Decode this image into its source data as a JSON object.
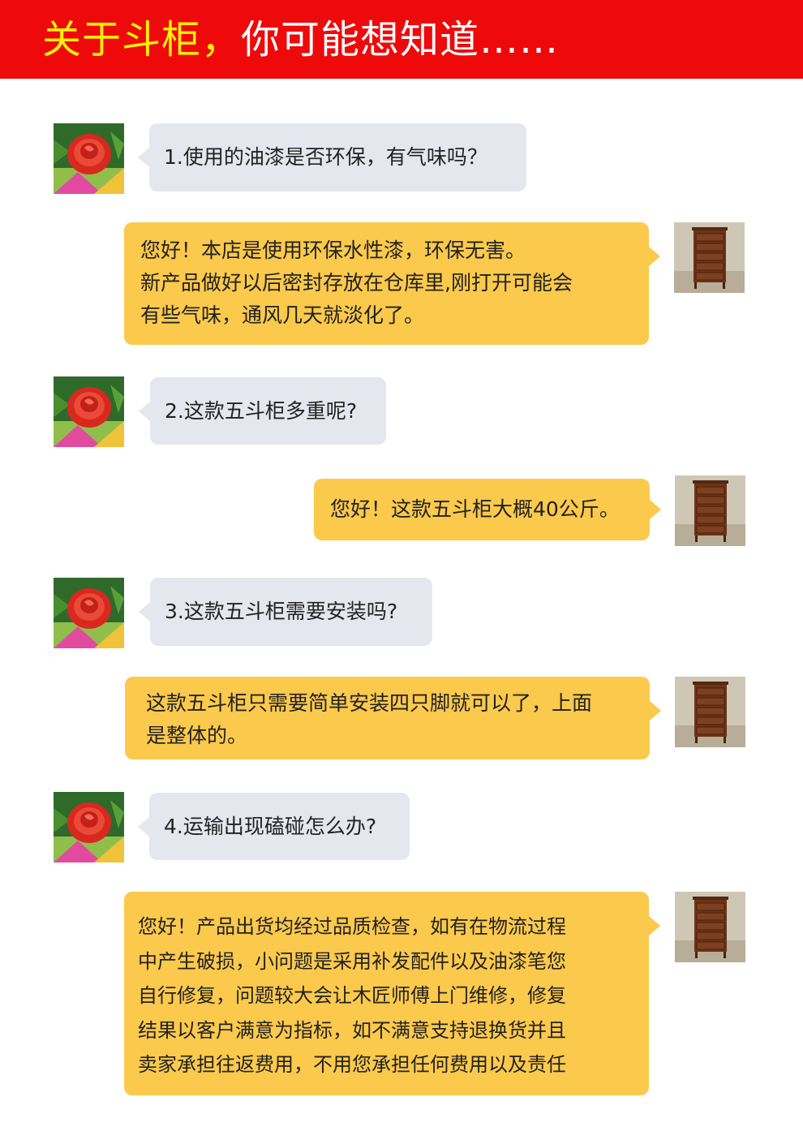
{
  "header": {
    "title_highlight": "关于斗柜，",
    "title_rest": "你可能想知道……"
  },
  "colors": {
    "header_bg": "#ee0a0b",
    "highlight_text": "#fff200",
    "question_bubble": "#e4e7ee",
    "answer_bubble": "#fbc94c"
  },
  "avatars": {
    "customer": "rose-photo-avatar",
    "seller": "dresser-photo-avatar"
  },
  "faq": [
    {
      "question": "1.使用的油漆是否环保，有气味吗？",
      "answer": [
        "您好！本店是使用环保水性漆，环保无害。",
        "新产品做好以后密封存放在仓库里,刚打开可能会",
        "有些气味，通风几天就淡化了。"
      ]
    },
    {
      "question": "2.这款五斗柜多重呢?",
      "answer": [
        "您好！这款五斗柜大概40公斤。"
      ]
    },
    {
      "question": "3.这款五斗柜需要安装吗?",
      "answer": [
        "这款五斗柜只需要简单安装四只脚就可以了，上面",
        "是整体的。"
      ]
    },
    {
      "question": "4.运输出现磕碰怎么办?",
      "answer": [
        "您好！产品出货均经过品质检查，如有在物流过程",
        "中产生破损，小问题是采用补发配件以及油漆笔您",
        "自行修复，问题较大会让木匠师傅上门维修，修复",
        "结果以客户满意为指标，如不满意支持退换货并且",
        "卖家承担往返费用，不用您承担任何费用以及责任"
      ]
    }
  ]
}
